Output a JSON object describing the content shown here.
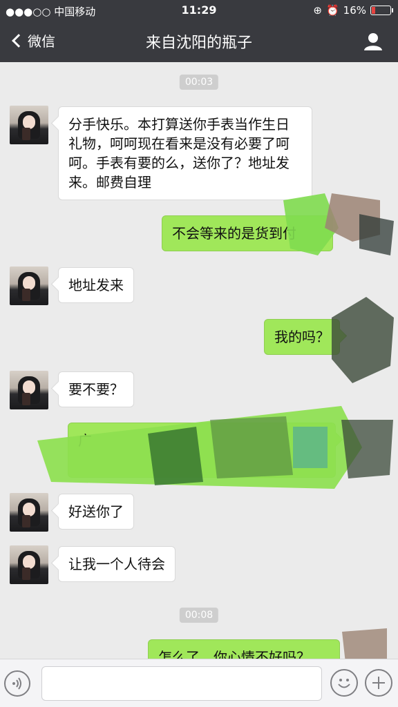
{
  "status_bar": {
    "carrier": "●●●○○ 中国移动",
    "time": "11:29",
    "battery": "16%"
  },
  "nav": {
    "back_label": "微信",
    "title": "来自沈阳的瓶子"
  },
  "messages": {
    "time1": "00:03",
    "m1": "分手快乐。本打算送你手表当作生日礼物，呵呵现在看来是没有必要了呵呵。手表有要的么，送你了？地址发来。邮费自理",
    "m2": "不会等来的是货到付",
    "m3": "地址发来",
    "m4": "我的吗？",
    "m5": "要不要？",
    "m6": "广",
    "m7": "好送你了",
    "m8": "让我一个人待会",
    "time2": "00:08",
    "m9": "怎么了，你心情不好吗？"
  },
  "colors": {
    "nav_bg": "#393a3f",
    "chat_bg": "#ebebeb",
    "sent_bubble": "#a0e75a",
    "received_bubble": "#ffffff"
  }
}
